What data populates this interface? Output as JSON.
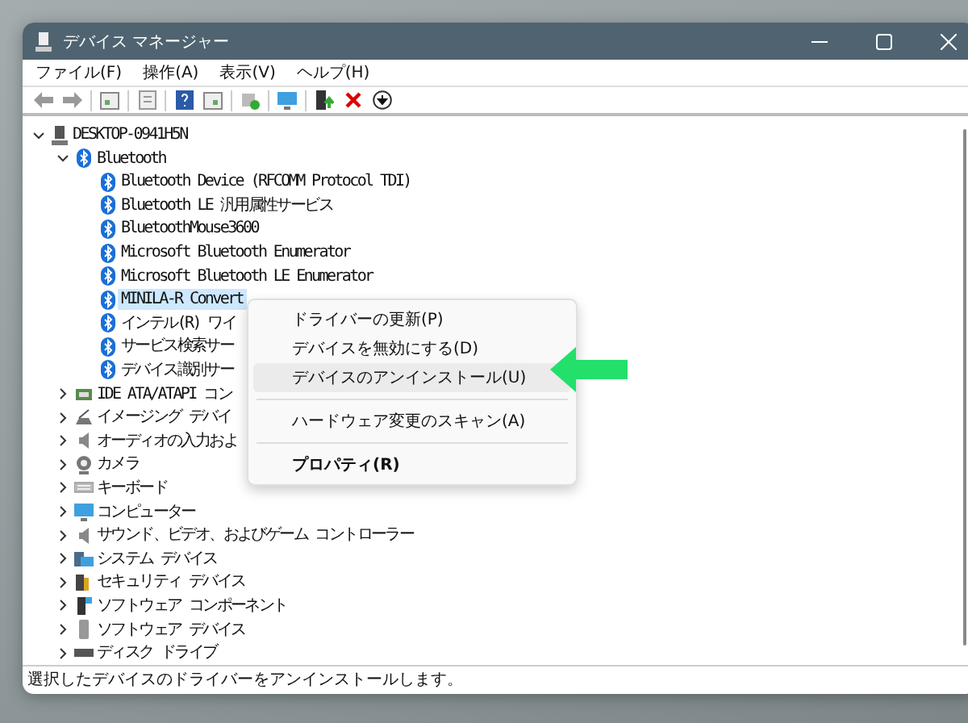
{
  "window": {
    "title": "デバイス マネージャー"
  },
  "menu_bar": [
    "ファイル(F)",
    "操作(A)",
    "表示(V)",
    "ヘルプ(H)"
  ],
  "tree": [
    {
      "label": "DESKTOP-0941H5N",
      "kind": "computer",
      "expanded": true,
      "selected": false,
      "children": [
        {
          "label": "Bluetooth",
          "kind": "bluetooth",
          "expanded": true,
          "selected": false,
          "children": [
            {
              "label": "Bluetooth Device (RFCOMM Protocol TDI)",
              "kind": "bluetooth",
              "selected": false
            },
            {
              "label": "Bluetooth LE 汎用属性サービス",
              "kind": "bluetooth",
              "selected": false
            },
            {
              "label": "BluetoothMouse3600",
              "kind": "bluetooth",
              "selected": false
            },
            {
              "label": "Microsoft Bluetooth Enumerator",
              "kind": "bluetooth",
              "selected": false
            },
            {
              "label": "Microsoft Bluetooth LE Enumerator",
              "kind": "bluetooth",
              "selected": false
            },
            {
              "label": "MINILA-R Convert",
              "kind": "bluetooth",
              "selected": true
            },
            {
              "label": "インテル(R) ワイ",
              "kind": "bluetooth",
              "selected": false
            },
            {
              "label": "サービス検索サー",
              "kind": "bluetooth",
              "selected": false
            },
            {
              "label": "デバイス識別サー",
              "kind": "bluetooth",
              "selected": false
            }
          ]
        },
        {
          "label": "IDE ATA/ATAPI コン",
          "kind": "ide",
          "expanded": false,
          "selected": false
        },
        {
          "label": "イメージング デバイ",
          "kind": "imaging",
          "expanded": false,
          "selected": false
        },
        {
          "label": "オーディオの入力およ",
          "kind": "audio",
          "expanded": false,
          "selected": false
        },
        {
          "label": "カメラ",
          "kind": "camera",
          "expanded": false,
          "selected": false
        },
        {
          "label": "キーボード",
          "kind": "keyboard",
          "expanded": false,
          "selected": false
        },
        {
          "label": "コンピューター",
          "kind": "monitor",
          "expanded": false,
          "selected": false
        },
        {
          "label": "サウンド、ビデオ、およびゲーム コントローラー",
          "kind": "audio",
          "expanded": false,
          "selected": false
        },
        {
          "label": "システム デバイス",
          "kind": "system",
          "expanded": false,
          "selected": false
        },
        {
          "label": "セキュリティ デバイス",
          "kind": "security",
          "expanded": false,
          "selected": false
        },
        {
          "label": "ソフトウェア コンポーネント",
          "kind": "component",
          "expanded": false,
          "selected": false
        },
        {
          "label": "ソフトウェア デバイス",
          "kind": "software",
          "expanded": false,
          "selected": false
        },
        {
          "label": "ディスク ドライブ",
          "kind": "disk",
          "expanded": false,
          "selected": false
        }
      ]
    }
  ],
  "context_menu": [
    {
      "kind": "item",
      "label": "ドライバーの更新(P)",
      "highlighted": false,
      "default": false
    },
    {
      "kind": "item",
      "label": "デバイスを無効にする(D)",
      "highlighted": false,
      "default": false
    },
    {
      "kind": "item",
      "label": "デバイスのアンインストール(U)",
      "highlighted": true,
      "default": false
    },
    {
      "kind": "separator"
    },
    {
      "kind": "item",
      "label": "ハードウェア変更のスキャン(A)",
      "highlighted": false,
      "default": false
    },
    {
      "kind": "separator"
    },
    {
      "kind": "item",
      "label": "プロパティ(R)",
      "highlighted": false,
      "default": true
    }
  ],
  "status_bar": "選択したデバイスのドライバーをアンインストールします。"
}
